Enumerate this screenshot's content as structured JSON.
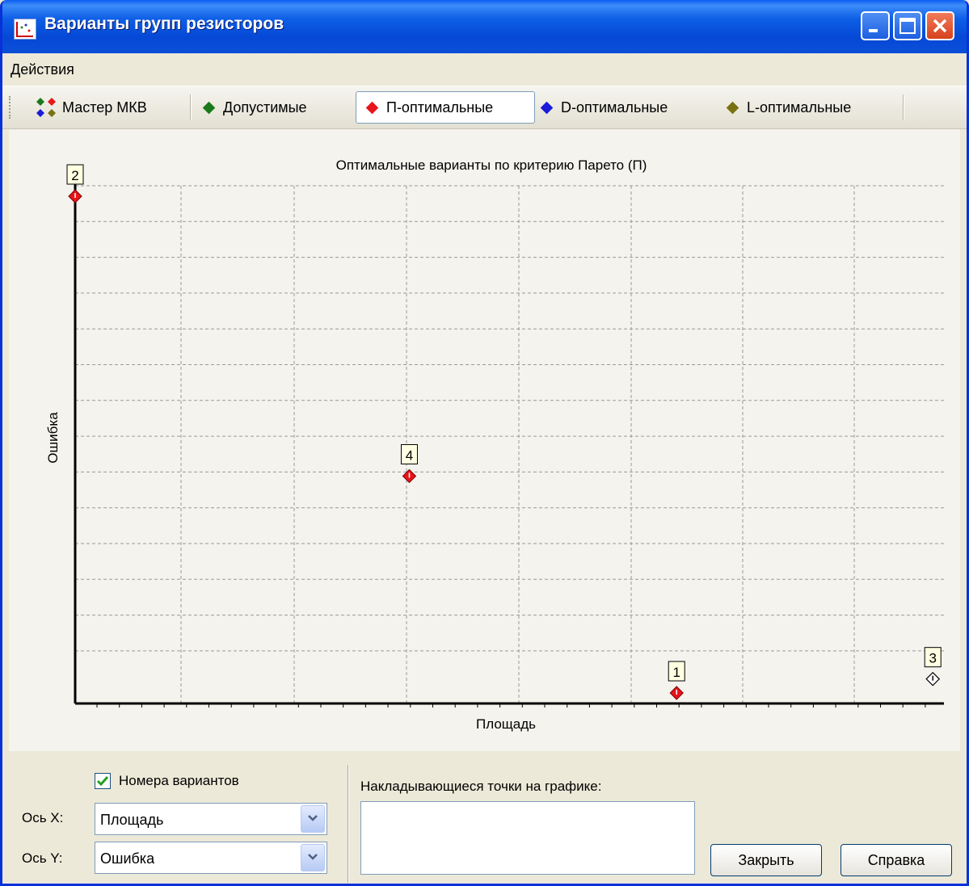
{
  "window": {
    "title": "Варианты групп резисторов"
  },
  "menu": {
    "actions": "Действия"
  },
  "toolbar": {
    "items": [
      {
        "label": "Мастер МКВ",
        "icon": "mkv-wizard-icon"
      },
      {
        "label": "Допустимые",
        "color": "#1a7a1a"
      },
      {
        "label": "П-оптимальные",
        "color": "#e8151b"
      },
      {
        "label": "D-оптимальные",
        "color": "#1b1bd8"
      },
      {
        "label": "L-оптимальные",
        "color": "#7a7212"
      }
    ]
  },
  "chart_data": {
    "type": "scatter",
    "title": "Оптимальные варианты по критерию Парето (П)",
    "xlabel": "Площадь",
    "ylabel": "Ошибка",
    "grid": true,
    "points": [
      {
        "label": "2",
        "x": 0.0,
        "y": 14.0,
        "pareto": true
      },
      {
        "label": "4",
        "x": 3.0,
        "y": 6.0,
        "pareto": true
      },
      {
        "label": "1",
        "x": 5.4,
        "y": -0.2,
        "pareto": true
      },
      {
        "label": "3",
        "x": 7.7,
        "y": 0.2,
        "pareto": false
      }
    ]
  },
  "options": {
    "show_numbers_label": "Номера вариантов",
    "show_numbers_checked": true
  },
  "axes": {
    "x_label": "Ось X:",
    "x_value": "Площадь",
    "y_label": "Ось Y:",
    "y_value": "Ошибка"
  },
  "overlap": {
    "label": "Накладывающиеся точки на графике:"
  },
  "buttons": {
    "close": "Закрыть",
    "help": "Справка"
  }
}
